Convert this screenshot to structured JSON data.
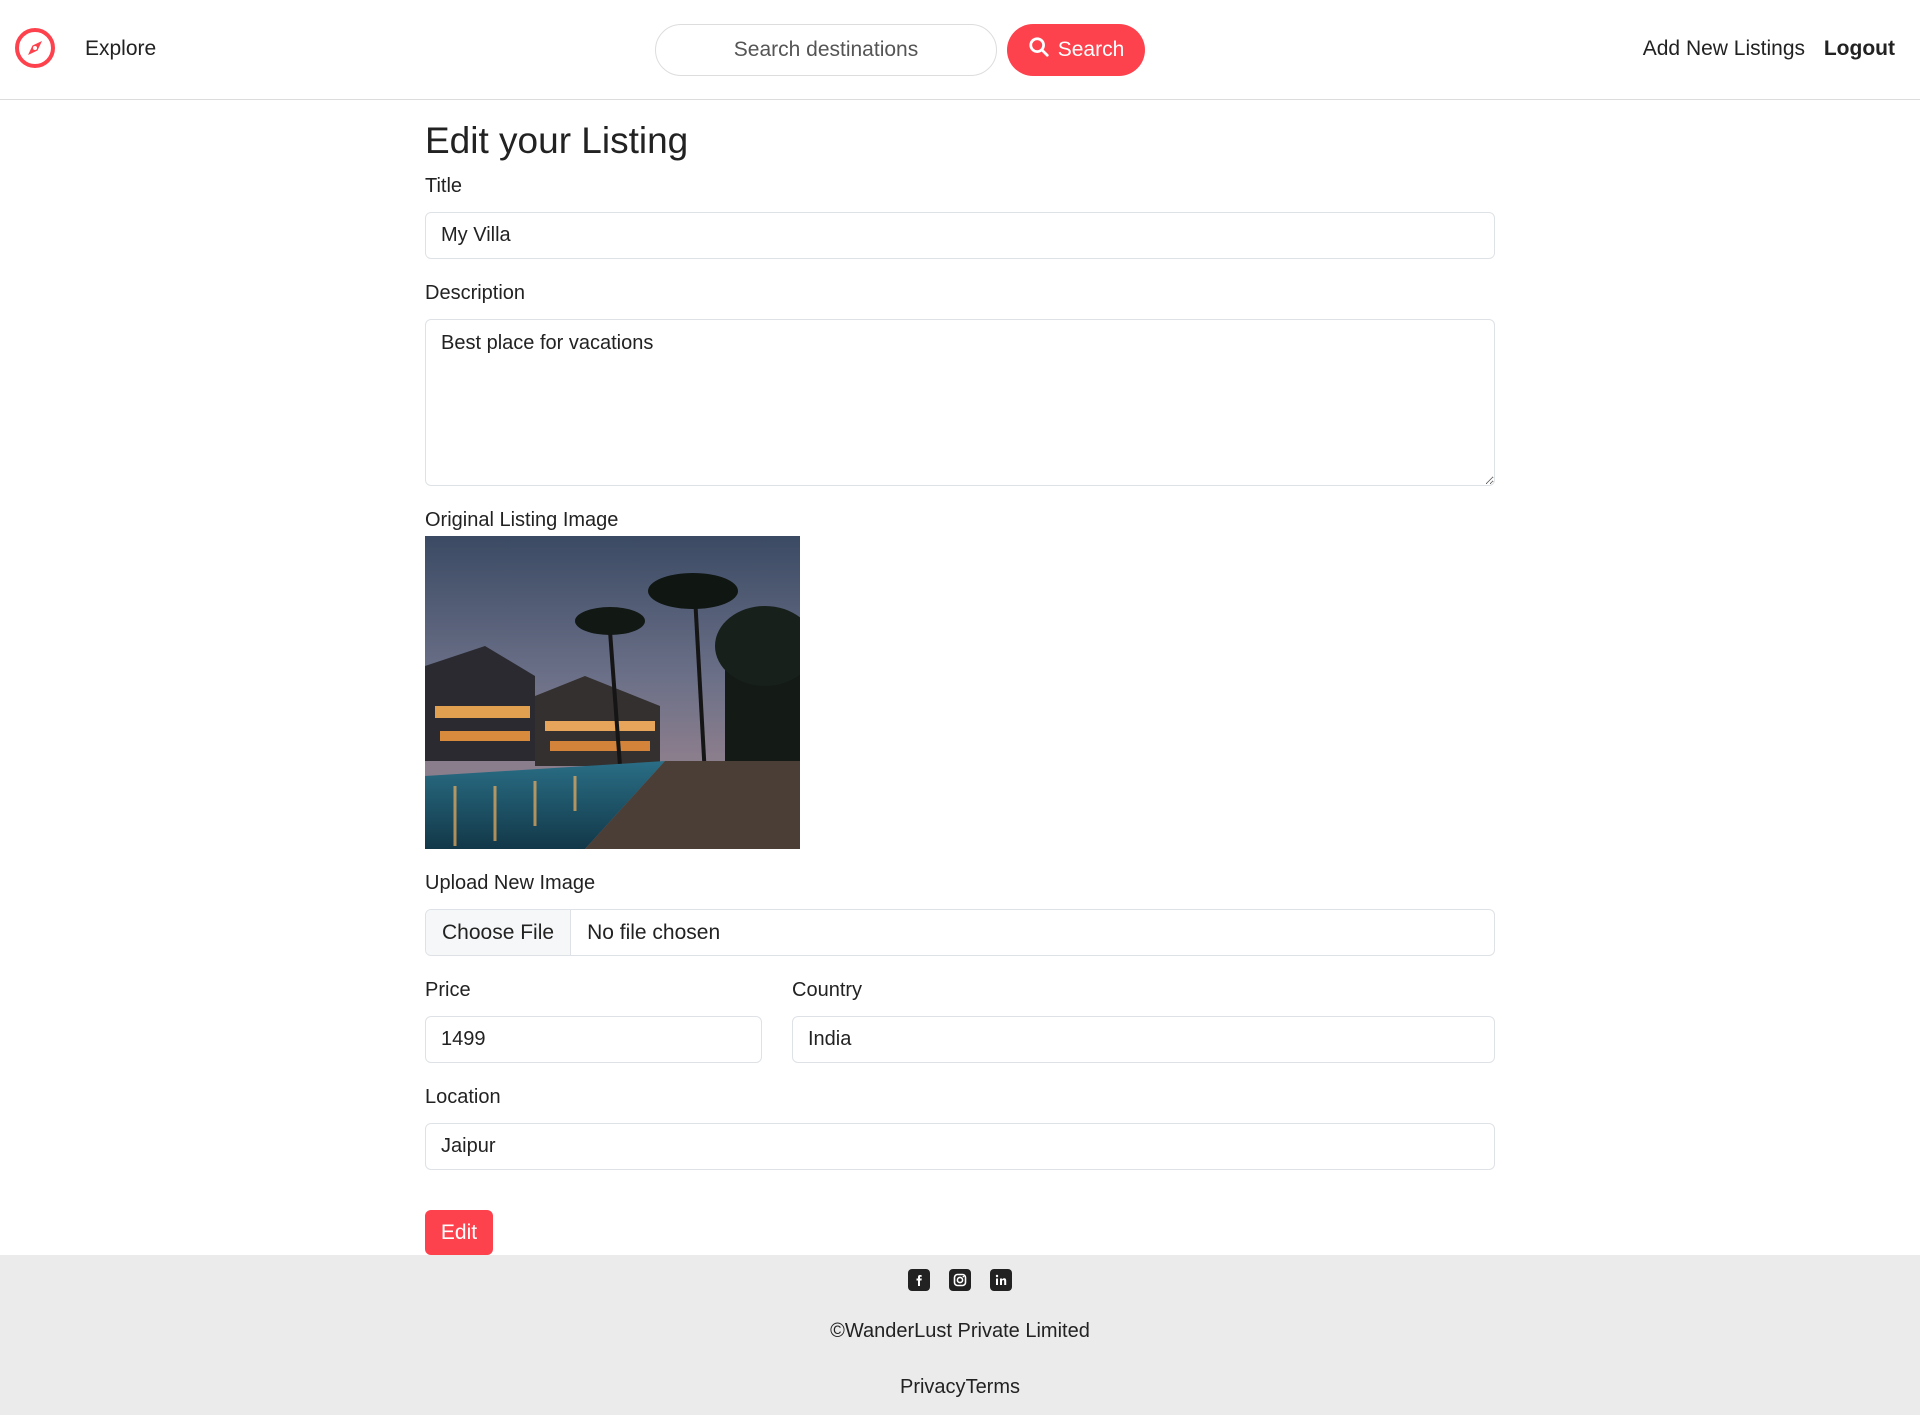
{
  "navbar": {
    "brand_icon": "compass-icon",
    "explore_label": "Explore",
    "search_placeholder": "Search destinations",
    "search_button_label": "Search",
    "add_listing_label": "Add New Listings",
    "logout_label": "Logout"
  },
  "form": {
    "page_title": "Edit your Listing",
    "title_label": "Title",
    "title_value": "My Villa",
    "description_label": "Description",
    "description_value": "Best place for vacations",
    "original_image_label": "Original Listing Image",
    "upload_label": "Upload New Image",
    "choose_file_label": "Choose File",
    "file_status": "No file chosen",
    "price_label": "Price",
    "price_value": "1499",
    "country_label": "Country",
    "country_value": "India",
    "location_label": "Location",
    "location_value": "Jaipur",
    "submit_label": "Edit"
  },
  "footer": {
    "social_icons": [
      "facebook-icon",
      "instagram-icon",
      "linkedin-icon"
    ],
    "copyright": "©WanderLust Private Limited",
    "privacy_label": "Privacy",
    "terms_label": "Terms"
  },
  "colors": {
    "accent": "#fe424d",
    "footer_bg": "#ebebeb",
    "text": "#222222"
  }
}
